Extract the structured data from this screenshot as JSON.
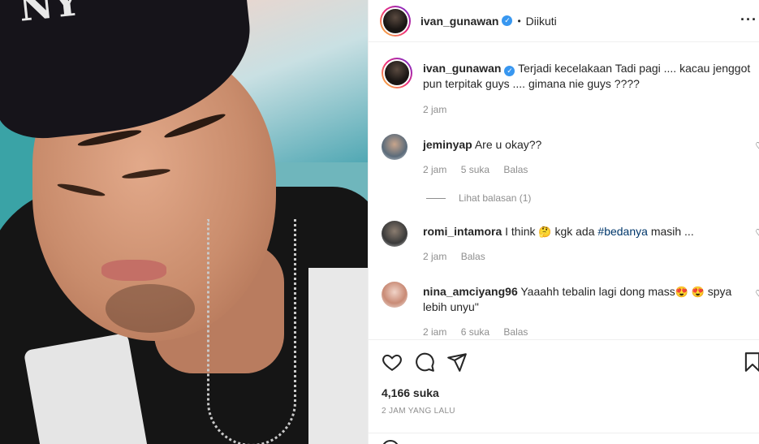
{
  "post": {
    "photo_alt_icon": "post-photo",
    "cap_logo": "NY",
    "author": "ivan_gunawan",
    "follow_state": "Diikuti",
    "more_icon": "more-horizontal-icon"
  },
  "caption": {
    "username": "ivan_gunawan",
    "text": "Terjadi kecelakaan Tadi pagi .... kacau jenggot pun terpitak guys .... gimana nie guys ????",
    "time": "2 jam"
  },
  "comments": [
    {
      "username": "jeminyap",
      "text": "Are u okay??",
      "time": "2 jam",
      "likes": "5 suka",
      "reply_label": "Balas",
      "view_replies": "Lihat balasan (1)"
    },
    {
      "username": "romi_intamora",
      "text_before": "I think",
      "emoji": "🤔",
      "text_mid": "kgk ada",
      "hashtag": "#bedanya",
      "text_after": "masih ...",
      "time": "2 jam",
      "reply_label": "Balas"
    },
    {
      "username": "nina_amciyang96",
      "text_before": "Yaaahh tebalin lagi dong mass",
      "emojis": "😍 😍",
      "text_after": "spya lebih unyu\"",
      "time": "2 iam",
      "likes": "6 suka",
      "reply_label": "Balas"
    }
  ],
  "actions": {
    "like_icon": "heart-icon",
    "comment_icon": "comment-icon",
    "share_icon": "send-icon",
    "save_icon": "bookmark-icon"
  },
  "stats": {
    "likes": "4,166 suka",
    "time_ago": "2 JAM YANG LALU"
  },
  "colors": {
    "verified": "#3897f0",
    "hashtag": "#00376b",
    "muted": "#8e8e8e"
  }
}
